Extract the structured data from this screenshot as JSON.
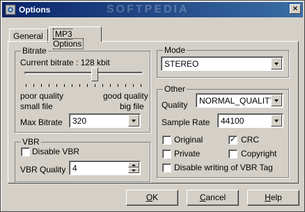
{
  "window": {
    "title": "Options",
    "close_label": "×",
    "watermark": "SOFTPEDIA"
  },
  "tabs": [
    {
      "label": "General"
    },
    {
      "label": "MP3 Options"
    }
  ],
  "bitrate": {
    "group_label": "Bitrate",
    "current": "Current bitrate : 128 kbit",
    "slider_value": 0.6,
    "left_label_1": "poor quality",
    "left_label_2": "small file",
    "right_label_1": "good quality",
    "right_label_2": "big file",
    "max_label": "Max Bitrate",
    "max_value": "320"
  },
  "vbr": {
    "group_label": "VBR",
    "disable_label": "Disable VBR",
    "disable_checked": false,
    "quality_label": "VBR Quality",
    "quality_value": "4"
  },
  "mode": {
    "group_label": "Mode",
    "value": "STEREO"
  },
  "other": {
    "group_label": "Other",
    "quality_label": "Quality",
    "quality_value": "NORMAL_QUALITY",
    "sample_rate_label": "Sample Rate",
    "sample_rate_value": "44100",
    "original_label": "Original",
    "crc_label": "CRC",
    "private_label": "Private",
    "copyright_label": "Copyright",
    "disable_vbr_tag_label": "Disable writing of VBR Tag",
    "checks": {
      "original": false,
      "crc": true,
      "private": false,
      "copyright": false,
      "disable_vbr_tag": false
    },
    "check_glyph": "✓"
  },
  "buttons": {
    "ok": {
      "u": "O",
      "rest": "K"
    },
    "cancel": {
      "u": "C",
      "rest": "ancel"
    },
    "help": {
      "u": "H",
      "rest": "elp"
    }
  }
}
